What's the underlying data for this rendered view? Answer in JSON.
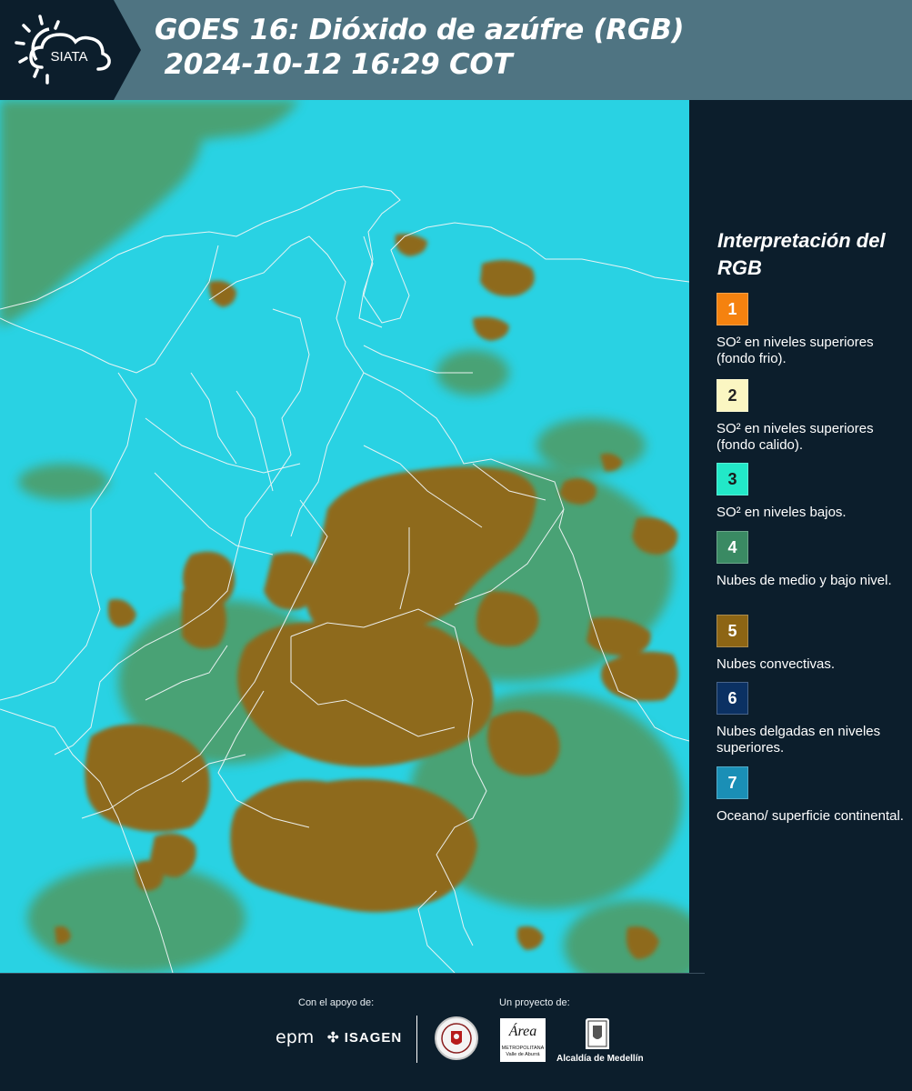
{
  "header": {
    "logo_text": "SIATA",
    "title_line1": "GOES 16: Dióxido de azúfre (RGB)",
    "title_line2": " 2024-10-12 16:29 COT"
  },
  "legend": {
    "title": "Interpretación del RGB",
    "items": [
      {
        "number": "1",
        "label": "SO² en niveles superiores (fondo frio).",
        "color": "#f5820f",
        "text_color": "#ffffff"
      },
      {
        "number": "2",
        "label": "SO² en niveles superiores (fondo calido).",
        "color": "#fbf6c2",
        "text_color": "#222222"
      },
      {
        "number": "3",
        "label": "SO² en niveles bajos.",
        "color": "#22e8c8",
        "text_color": "#1a1a1a"
      },
      {
        "number": "4",
        "label": "Nubes de medio y bajo nivel.",
        "color": "#3a8a63",
        "text_color": "#ffffff"
      },
      {
        "number": "5",
        "label": "Nubes convectivas.",
        "color": "#8d6514",
        "text_color": "#ffffff"
      },
      {
        "number": "6",
        "label": "Nubes delgadas en niveles superiores.",
        "color": "#0b3163",
        "text_color": "#ffffff"
      },
      {
        "number": "7",
        "label": "Oceano/ superficie continental.",
        "color": "#1a8fb6",
        "text_color": "#ffffff"
      }
    ]
  },
  "footer": {
    "support_label": "Con el apoyo de:",
    "project_label": "Un proyecto de:",
    "epm": "epm",
    "isagen": "ISAGEN",
    "area_logo_text": "Área",
    "area_logo_sub": "METROPOLITANA Valle de Aburrá",
    "alcaldia": "Alcaldía de Medellín"
  },
  "colors": {
    "background": "#0c1e2c",
    "header": "#4f7482",
    "map_base": "#27cfe0",
    "convective": "#8d6514",
    "low_cloud": "#3a8a63"
  }
}
